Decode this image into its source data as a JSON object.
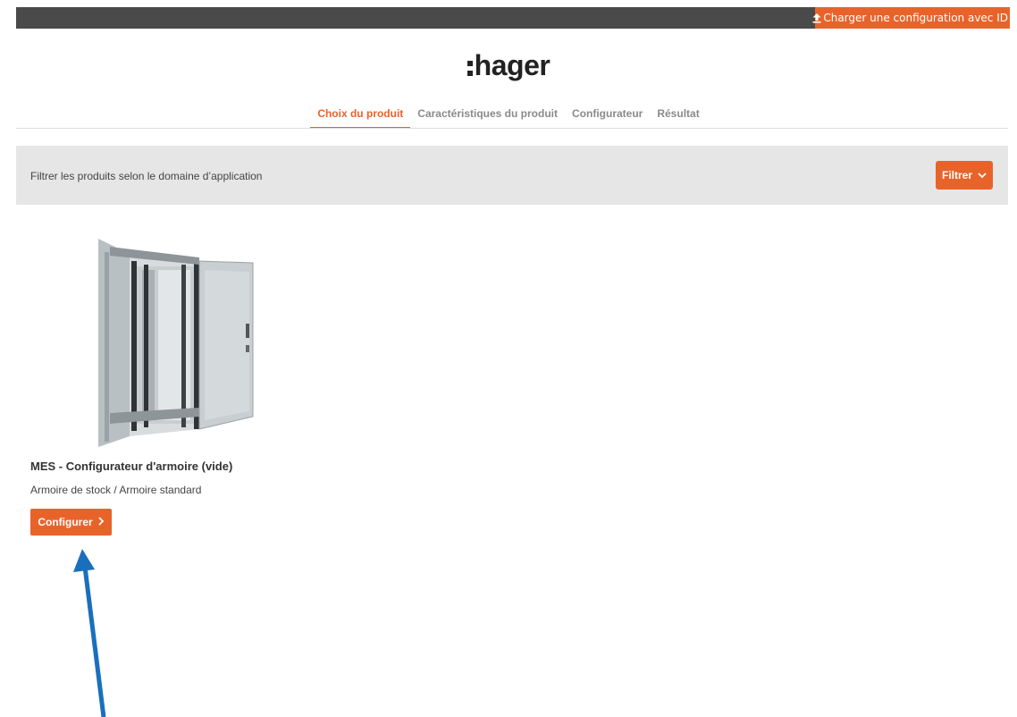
{
  "topbar": {
    "load_label": "Charger une configuration avec ID",
    "load_icon": "upload-icon"
  },
  "logo": {
    "text": "hager"
  },
  "steps": [
    {
      "label": "Choix du produit",
      "active": true
    },
    {
      "label": "Caractéristiques du produit",
      "active": false
    },
    {
      "label": "Configurateur",
      "active": false
    },
    {
      "label": "Résultat",
      "active": false
    }
  ],
  "filter": {
    "text": "Filtrer les produits selon le domaine d’application",
    "button_label": "Filtrer",
    "button_icon": "chevron-down-icon"
  },
  "product": {
    "title": "MES - Configurateur d'armoire (vide)",
    "subtitle": "Armoire de stock / Armoire standard",
    "button_label": "Configurer",
    "button_icon": "chevron-right-icon"
  },
  "colors": {
    "accent": "#e8632a",
    "topbar": "#4a4a4a",
    "filterbar": "#e6e6e6",
    "annotation_arrow": "#1a6fbd"
  }
}
